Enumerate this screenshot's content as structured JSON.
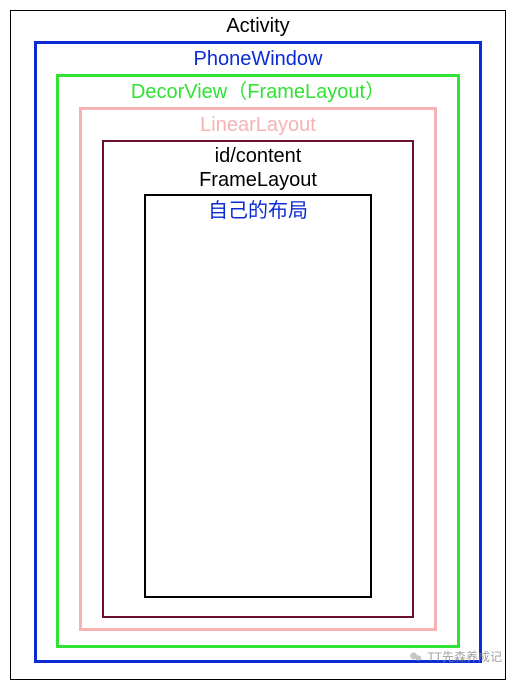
{
  "layers": {
    "activity": {
      "label": "Activity"
    },
    "phoneWindow": {
      "label": "PhoneWindow"
    },
    "decorView": {
      "label": "DecorView（FrameLayout）"
    },
    "linearLayout": {
      "label": "LinearLayout"
    },
    "idContent": {
      "label_line1": "id/content",
      "label_line2": "FrameLayout"
    },
    "ownLayout": {
      "label": "自己的布局"
    }
  },
  "watermark": {
    "text": "TT先森养成记"
  },
  "colors": {
    "activity": "#000000",
    "phoneWindow": "#0a2bd6",
    "decorView": "#2fe233",
    "linearLayout": "#f6b3b3",
    "idContent": "#6b0f2b",
    "ownLayout": "#000000"
  }
}
